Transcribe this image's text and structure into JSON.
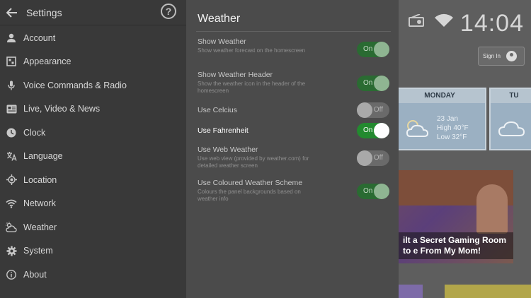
{
  "menu": {
    "title": "Settings",
    "help_symbol": "?",
    "items": [
      {
        "label": "Account",
        "icon": "person-icon"
      },
      {
        "label": "Appearance",
        "icon": "appearance-icon"
      },
      {
        "label": "Voice Commands & Radio",
        "icon": "microphone-icon"
      },
      {
        "label": "Live, Video & News",
        "icon": "news-icon"
      },
      {
        "label": "Clock",
        "icon": "clock-icon"
      },
      {
        "label": "Language",
        "icon": "translate-icon"
      },
      {
        "label": "Location",
        "icon": "location-icon"
      },
      {
        "label": "Network",
        "icon": "wifi-icon"
      },
      {
        "label": "Weather",
        "icon": "weather-icon"
      },
      {
        "label": "System",
        "icon": "gear-icon"
      },
      {
        "label": "About",
        "icon": "info-icon"
      }
    ]
  },
  "panel": {
    "title": "Weather",
    "settings": [
      {
        "title": "Show Weather",
        "desc": "Show weather forecast on the homescreen",
        "state": "On"
      },
      {
        "title": "Show Weather Header",
        "desc": "Show the weather icon in the header of the homescreen",
        "state": "On"
      },
      {
        "title": "Use Celcius",
        "desc": "",
        "state": "Off"
      },
      {
        "title": "Use Fahrenheit",
        "desc": "",
        "state": "On"
      },
      {
        "title": "Use Web Weather",
        "desc": "Use web view (provided by weather.com) for detailed weather screen",
        "state": "Off"
      },
      {
        "title": "Use Coloured Weather Scheme",
        "desc": "Colours the panel backgrounds based on weather info",
        "state": "On"
      }
    ]
  },
  "background": {
    "clock": "14:04",
    "sign_in": "Sign In",
    "day1": "MONDAY",
    "day2": "TU",
    "date": "23 Jan",
    "high": "High 40°F",
    "low": "Low 32°F",
    "news_caption": "ilt a Secret Gaming Room to e From My Mom!",
    "accent_colors": {
      "toggle_on": "#238a2f",
      "panel": "#4b4b4b",
      "menu": "#393939"
    }
  }
}
